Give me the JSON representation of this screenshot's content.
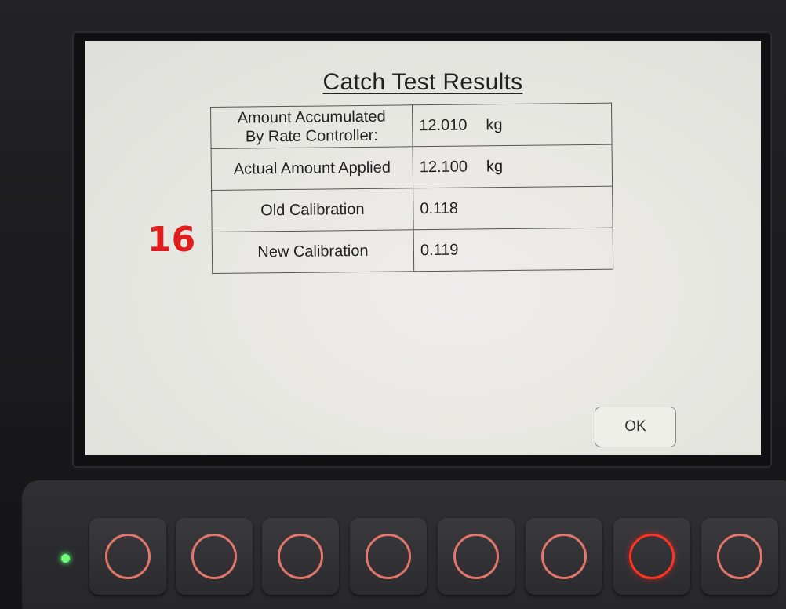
{
  "dialog": {
    "title": "Catch Test Results",
    "rows": [
      {
        "label_line1": "Amount Accumulated",
        "label_line2": "By Rate Controller:",
        "value": "12.010",
        "unit": "kg"
      },
      {
        "label_line1": "Actual Amount Applied",
        "label_line2": "",
        "value": "12.100",
        "unit": "kg"
      },
      {
        "label_line1": "Old Calibration",
        "label_line2": "",
        "value": "0.118",
        "unit": ""
      },
      {
        "label_line1": "New Calibration",
        "label_line2": "",
        "value": "0.119",
        "unit": ""
      }
    ],
    "ok_label": "OK"
  },
  "annotation": {
    "step_number": "16",
    "color": "#e11c1c"
  },
  "keypad": {
    "led_color": "#6dff7a",
    "ring_color": "#e0776a",
    "highlight_ring_color": "#ff3322",
    "keys": [
      {
        "icon": "ring-icon",
        "highlighted": false
      },
      {
        "icon": "ring-icon",
        "highlighted": false
      },
      {
        "icon": "ring-icon",
        "highlighted": false
      },
      {
        "icon": "ring-icon",
        "highlighted": false
      },
      {
        "icon": "ring-icon",
        "highlighted": false
      },
      {
        "icon": "ring-icon",
        "highlighted": false
      },
      {
        "icon": "ring-icon",
        "highlighted": true
      },
      {
        "icon": "ring-icon",
        "highlighted": false
      }
    ]
  }
}
